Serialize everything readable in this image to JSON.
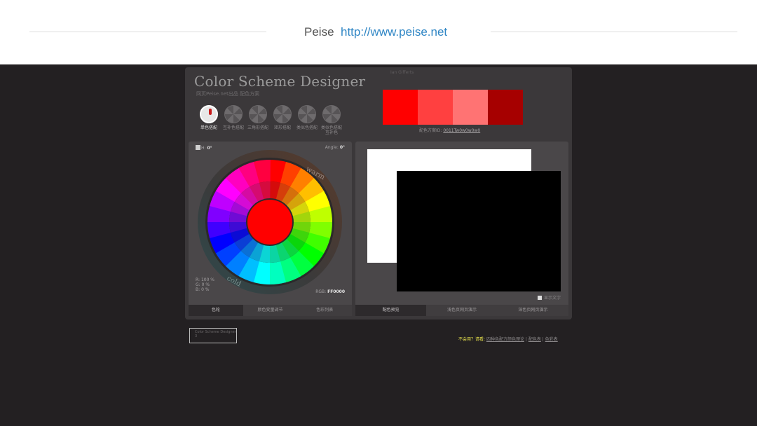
{
  "header": {
    "brand": "Peise",
    "link": "http://www.peise.net"
  },
  "app": {
    "title": "Color Scheme Designer",
    "subtitle": "网页Peise.net出品 配色方案",
    "tagline": "Ian Gifferts"
  },
  "modes": [
    {
      "label": "单色搭配",
      "active": true
    },
    {
      "label": "互补色搭配",
      "active": false
    },
    {
      "label": "三角形搭配",
      "active": false
    },
    {
      "label": "矩形搭配",
      "active": false
    },
    {
      "label": "类似色搭配",
      "active": false
    },
    {
      "label": "类似色搭配互补色",
      "active": false
    }
  ],
  "swatches": [
    "#ff0000",
    "#ff4040",
    "#ff7373",
    "#a60000"
  ],
  "scheme": {
    "label": "配色方案ID:",
    "id": "0011Tw0w0w0w0"
  },
  "wheel": {
    "hue_label": "H:",
    "hue_value": "0°",
    "angle_label": "Angle:",
    "angle_value": "0°",
    "warm_label": "warm",
    "cold_label": "cold",
    "rgb_readout": {
      "r_label": "R:",
      "r": "100 %",
      "g_label": "G:",
      "g": "0 %",
      "b_label": "B:",
      "b": "0 %"
    },
    "rgb_label": "RGB:",
    "rgb_hex": "FF0000",
    "center_color": "#ff0000"
  },
  "left_tabs": [
    "色轮",
    "颜色变量调节",
    "色彩列表"
  ],
  "right_tabs": [
    "配色预览",
    "浅色页网页演示",
    "深色页网页演示"
  ],
  "preview": {
    "show_text_label": "显示文字"
  },
  "bottom": {
    "img_alt": "Color Scheme Designer 3",
    "help_q": "不会用？请看:",
    "help_link_1": "四种色配方颜色理论",
    "help_link_2": "配色表",
    "help_link_3": "色彩表"
  }
}
